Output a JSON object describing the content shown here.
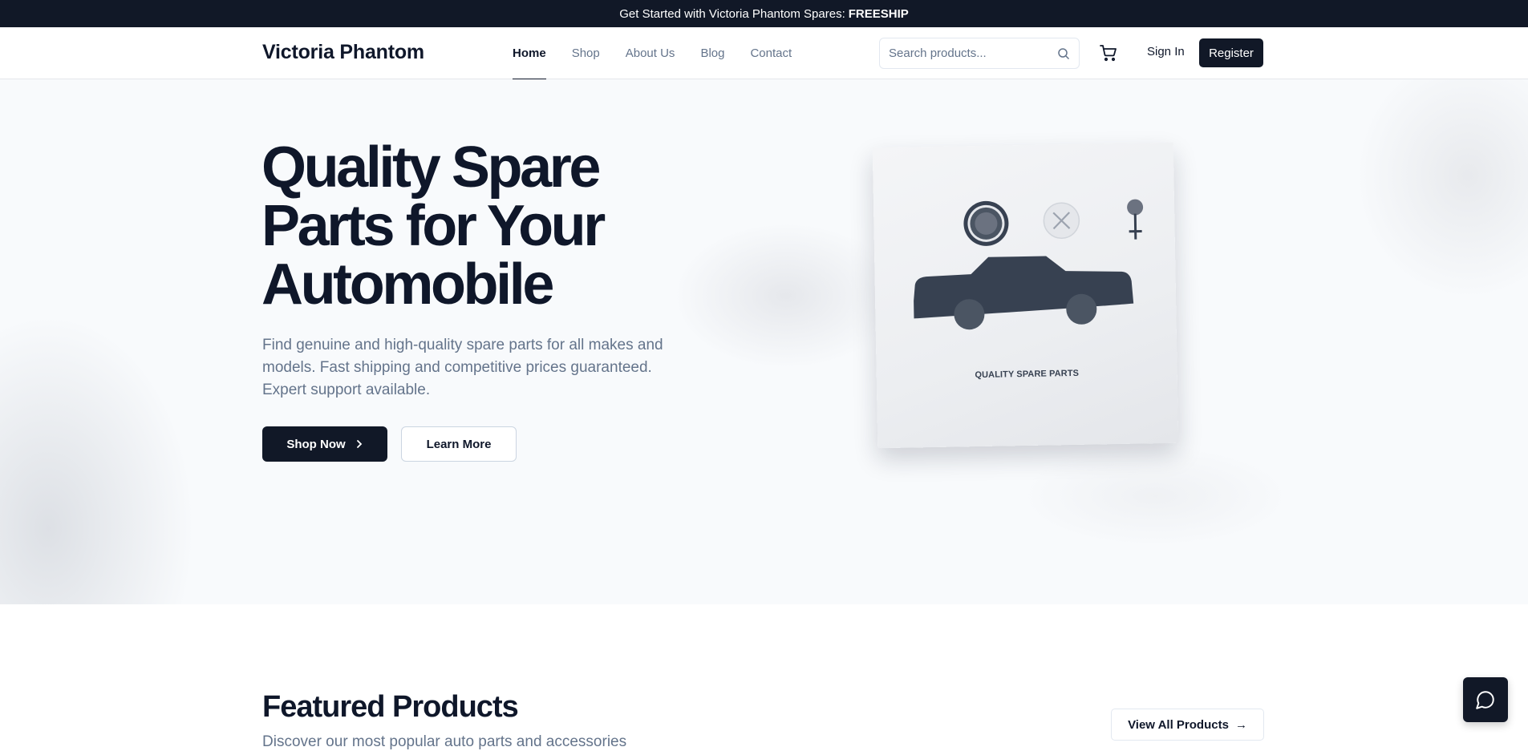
{
  "promo": {
    "text": "Get Started with Victoria Phantom Spares:",
    "code": "FREESHIP"
  },
  "header": {
    "brand": "Victoria Phantom",
    "nav": [
      "Home",
      "Shop",
      "About Us",
      "Blog",
      "Contact"
    ],
    "active_nav": "Home",
    "search_placeholder": "Search products...",
    "signin_label": "Sign In",
    "register_label": "Register",
    "icons": {
      "search": "search-icon",
      "cart": "cart-icon"
    }
  },
  "hero": {
    "title": "Quality Spare Parts for Your Automobile",
    "subtitle": "Find genuine and high-quality spare parts for all makes and models. Fast shipping and competitive prices guaranteed. Expert support available.",
    "shop_now_label": "Shop Now",
    "learn_more_label": "Learn More",
    "card_label": "QUALITY SPARE PARTS"
  },
  "featured": {
    "title": "Featured Products",
    "subtitle": "Discover our most popular auto parts and accessories",
    "view_all_label": "View All Products",
    "view_all_arrow": "→"
  },
  "colors": {
    "primary": "#111827",
    "muted": "#64748b",
    "background": "#f8fafc"
  }
}
